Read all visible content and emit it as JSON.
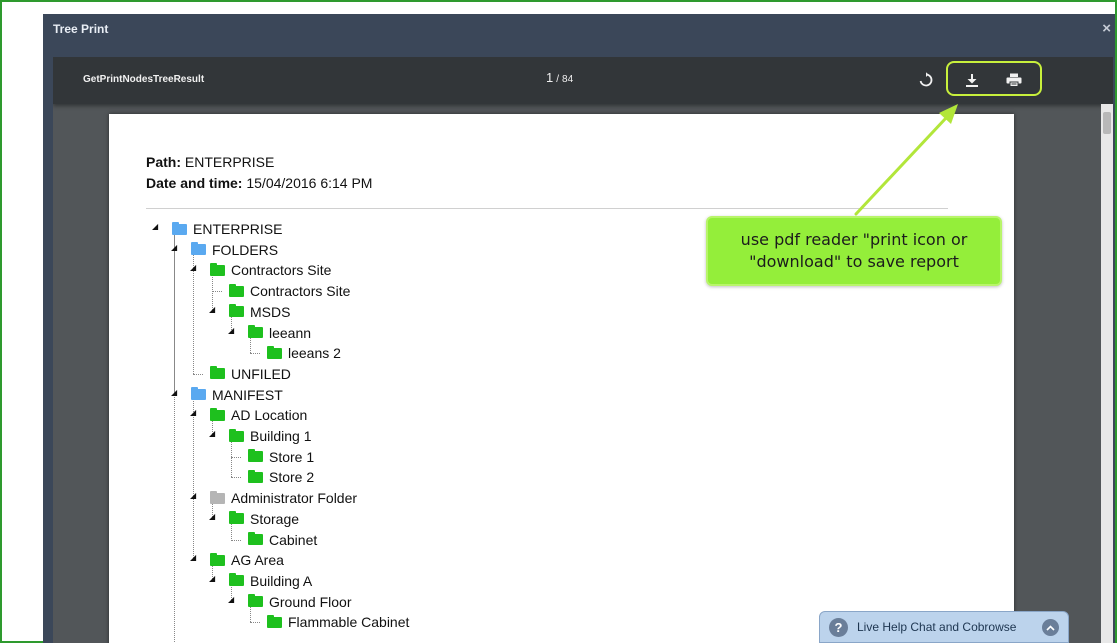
{
  "modal": {
    "title": "Tree Print",
    "close_glyph": "×"
  },
  "viewer": {
    "document_name": "GetPrintNodesTreeResult",
    "current_page": "1",
    "page_separator": "/",
    "total_pages": "84",
    "icons": [
      "rotate-icon",
      "download-icon",
      "print-icon"
    ]
  },
  "report": {
    "path_label": "Path:",
    "path_value": "ENTERPRISE",
    "datetime_label": "Date and time:",
    "datetime_value": "15/04/2016 6:14 PM"
  },
  "tree": [
    {
      "label": "ENTERPRISE",
      "folder": "blue"
    },
    {
      "label": "FOLDERS",
      "folder": "blue"
    },
    {
      "label": "Contractors Site",
      "folder": "green"
    },
    {
      "label": "Contractors Site",
      "folder": "green"
    },
    {
      "label": "MSDS",
      "folder": "green"
    },
    {
      "label": "leeann",
      "folder": "green"
    },
    {
      "label": "leeans 2",
      "folder": "green"
    },
    {
      "label": "UNFILED",
      "folder": "green"
    },
    {
      "label": "MANIFEST",
      "folder": "blue"
    },
    {
      "label": "AD Location",
      "folder": "green"
    },
    {
      "label": "Building 1",
      "folder": "green"
    },
    {
      "label": "Store 1",
      "folder": "green"
    },
    {
      "label": "Store 2",
      "folder": "green"
    },
    {
      "label": "Administrator Folder",
      "folder": "gray"
    },
    {
      "label": "Storage",
      "folder": "green"
    },
    {
      "label": "Cabinet",
      "folder": "green"
    },
    {
      "label": "AG Area",
      "folder": "green"
    },
    {
      "label": "Building A",
      "folder": "green"
    },
    {
      "label": "Ground Floor",
      "folder": "green"
    },
    {
      "label": "Flammable Cabinet",
      "folder": "green"
    }
  ],
  "callout": {
    "text_line1": "use pdf reader \"print icon or",
    "text_line2": "\"download\" to save report",
    "color": "#94ee3a"
  },
  "live_help": {
    "label": "Live Help Chat and Cobrowse",
    "icon": "question-icon",
    "chevron": "chevron-up-icon"
  },
  "colors": {
    "frame_border": "#2e9a2e",
    "highlight": "#c8f03c",
    "folder_blue": "#5aa9f0",
    "folder_green": "#1ec01e",
    "folder_gray": "#b5b5b5"
  }
}
